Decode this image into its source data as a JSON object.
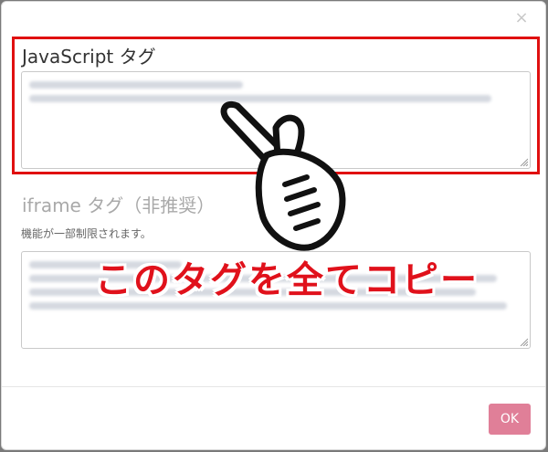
{
  "dialog": {
    "close_label": "×",
    "js_section": {
      "title": "JavaScript タグ"
    },
    "iframe_section": {
      "title": "iframe タグ（非推奨）",
      "note": "機能が一部制限されます。"
    },
    "ok_label": "OK"
  },
  "annotation": {
    "callout_text": "このタグを全てコピー",
    "callout_color": "#e0111b",
    "highlight_color": "#e01010",
    "pointer_icon": "pointing-hand-icon"
  },
  "colors": {
    "ok_button": "#e07f98"
  }
}
